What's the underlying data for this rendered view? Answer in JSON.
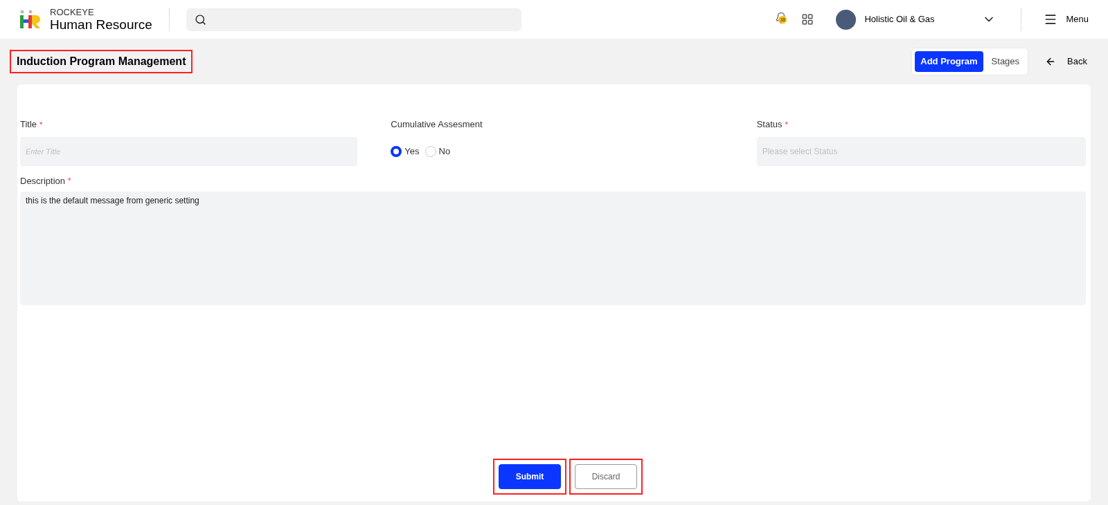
{
  "header": {
    "brand_small": "ROCKEYE",
    "brand_large": "Human Resource",
    "notification_count": "38",
    "company": "Holistic Oil & Gas",
    "menu_label": "Menu"
  },
  "page": {
    "title": "Induction Program Management",
    "title_highlighted": true,
    "tabs": [
      {
        "label": "Add Program",
        "selected": true
      },
      {
        "label": "Stages",
        "selected": false
      }
    ],
    "back_label": "Back"
  },
  "form": {
    "title_field": {
      "label": "Title",
      "required_mark": "*",
      "placeholder": "Enter Title"
    },
    "assessment": {
      "label": "Cumulative Assesment",
      "options": [
        {
          "label": "Yes",
          "selected": true
        },
        {
          "label": "No",
          "selected": false
        }
      ]
    },
    "status_field": {
      "label": "Status",
      "required_mark": "*",
      "placeholder": "Please select Status"
    },
    "description": {
      "label": "Description",
      "required_mark": "*",
      "value": "this is the default message from generic setting"
    }
  },
  "actions": [
    {
      "kind": "primary",
      "label": "Submit",
      "highlighted": true
    },
    {
      "kind": "secondary",
      "label": "Discard",
      "highlighted": true
    }
  ]
}
